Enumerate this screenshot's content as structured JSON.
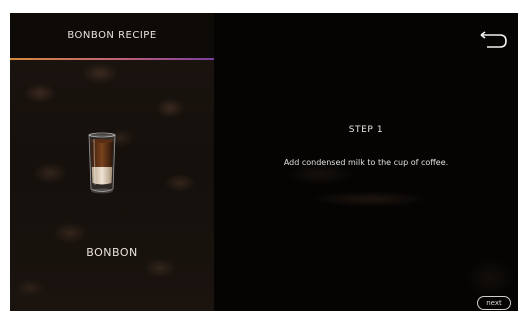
{
  "panel": {
    "title": "BONBON RECIPE",
    "drink_name": "BONBON",
    "cup_icon": "bonbon-glass-icon"
  },
  "header": {
    "back_icon": "return-arrow-icon"
  },
  "step": {
    "title": "STEP 1",
    "description": "Add condensed milk to the cup of coffee."
  },
  "footer": {
    "next_label": "next"
  },
  "colors": {
    "accent_orange": "#d58a3c",
    "accent_purple": "#7a3fa0",
    "background": "#050403"
  }
}
